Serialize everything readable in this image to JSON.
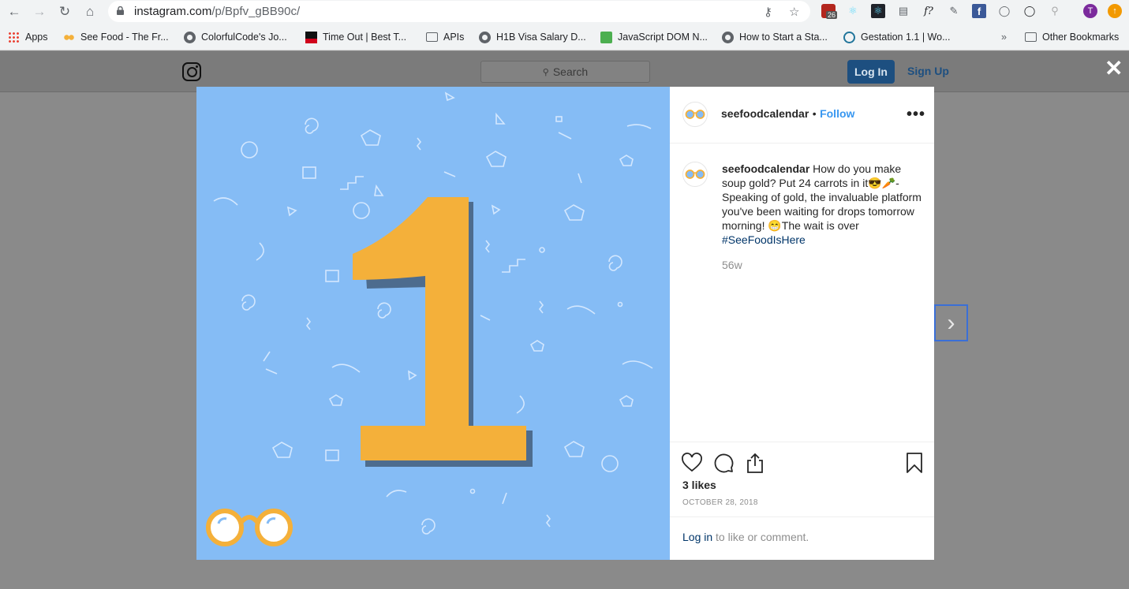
{
  "browser": {
    "url_host": "instagram.com",
    "url_path": "/p/Bpfv_gBB90c/",
    "extension_badge": "26",
    "profile_initial": "T",
    "bookmarks": [
      {
        "label": "Apps",
        "icon": "apps-grid-icon"
      },
      {
        "label": "See Food - The Fr...",
        "icon": "glasses-icon"
      },
      {
        "label": "ColorfulCode's Jo...",
        "icon": "globe-icon"
      },
      {
        "label": "Time Out | Best T...",
        "icon": "timeout-icon"
      },
      {
        "label": "APIs",
        "icon": "folder-icon"
      },
      {
        "label": "H1B Visa Salary D...",
        "icon": "globe-icon"
      },
      {
        "label": "JavaScript DOM N...",
        "icon": "w3-icon"
      },
      {
        "label": "How to Start a Sta...",
        "icon": "globe-icon"
      },
      {
        "label": "Gestation 1.1 | Wo...",
        "icon": "wordpress-icon"
      }
    ],
    "overflow": "»",
    "other_bookmarks": "Other Bookmarks"
  },
  "instagram": {
    "search_placeholder": "Search",
    "login_label": "Log In",
    "signup_label": "Sign Up"
  },
  "post": {
    "username": "seefoodcalendar",
    "follow_sep": "•",
    "follow_label": "Follow",
    "caption_text": "How do you make soup gold? Put 24 carrots in it😎🥕- Speaking of gold, the invaluable platform you've been waiting for drops tomorrow morning! 😁The wait is over",
    "hashtag": "#SeeFoodIsHere",
    "age": "56w",
    "likes": "3 likes",
    "date": "OCTOBER 28, 2018",
    "comment_login": "Log in",
    "comment_rest": " to like or comment."
  },
  "colors": {
    "image_bg": "#85bcf5",
    "numeral": "#f4b03a",
    "link_blue": "#3897f0",
    "hashtag": "#003569"
  }
}
